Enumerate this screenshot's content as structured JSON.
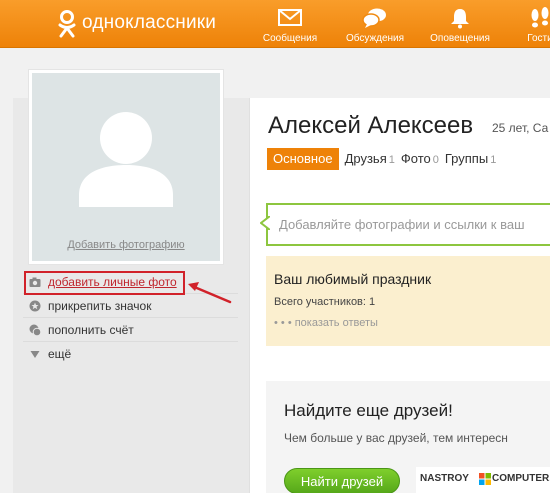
{
  "header": {
    "brand": "одноклассники",
    "nav": [
      {
        "label": "Сообщения",
        "icon": "envelope-icon"
      },
      {
        "label": "Обсуждения",
        "icon": "chat-bubbles-icon"
      },
      {
        "label": "Оповещения",
        "icon": "bell-icon"
      },
      {
        "label": "Гости",
        "icon": "footprints-icon"
      }
    ]
  },
  "sidebar": {
    "add_photo_link": "Добавить фотографию",
    "menu": [
      {
        "label": "добавить личные фото",
        "icon": "camera-icon"
      },
      {
        "label": "прикрепить значок",
        "icon": "badge-icon"
      },
      {
        "label": "пополнить счёт",
        "icon": "coins-icon"
      },
      {
        "label": "ещё",
        "icon": "triangle-down-icon"
      }
    ]
  },
  "profile": {
    "name": "Алексей Алексеев",
    "age_info": "25 лет, Са",
    "tabs": [
      {
        "label": "Основное",
        "count": ""
      },
      {
        "label": "Друзья",
        "count": "1"
      },
      {
        "label": "Фото",
        "count": "0"
      },
      {
        "label": "Группы",
        "count": "1"
      }
    ]
  },
  "share": {
    "placeholder": "Добавляйте фотографии и ссылки к ваш"
  },
  "holiday": {
    "title": "Ваш любимый праздник",
    "participants": "Всего участников: 1",
    "show_answers": "• • • показать ответы"
  },
  "friends_promo": {
    "title": "Найдите еще друзей!",
    "subtitle": "Чем больше у вас друзей, тем интересн",
    "button": "Найти друзей"
  },
  "watermark": {
    "left": "NASTROY",
    "right": "COMPUTER.RU"
  },
  "colors": {
    "brand_orange": "#ee8208",
    "accent_green": "#8dc63f",
    "highlight_red": "#d1222a"
  }
}
